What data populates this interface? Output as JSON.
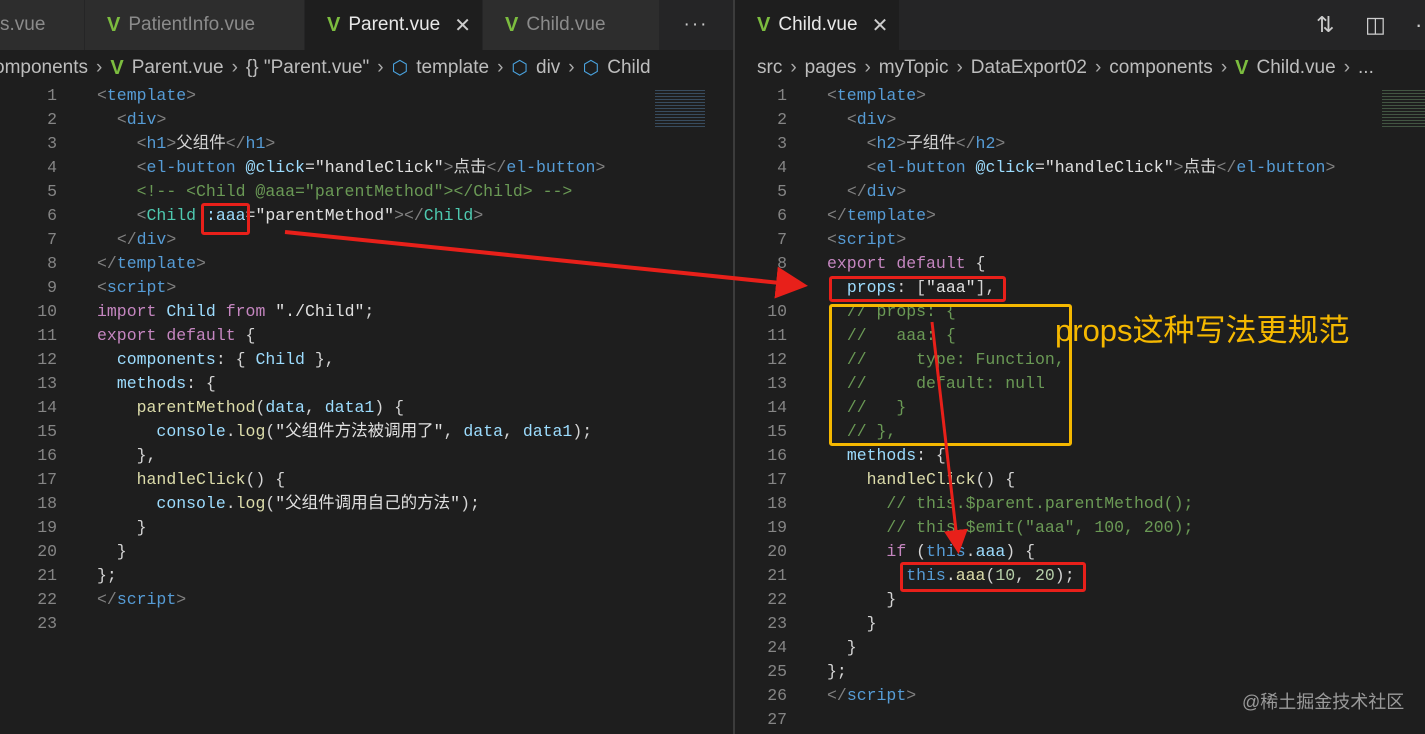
{
  "left": {
    "tabs": [
      {
        "label": "s.vue",
        "active": false
      },
      {
        "label": "PatientInfo.vue",
        "active": false
      },
      {
        "label": "Parent.vue",
        "active": true
      },
      {
        "label": "Child.vue",
        "active": false
      }
    ],
    "more": "···",
    "crumbs": [
      "omponents",
      "Parent.vue",
      "{} \"Parent.vue\"",
      "template",
      "div",
      "Child"
    ],
    "lines": [
      [
        [
          "p",
          "<"
        ],
        [
          "t",
          "template"
        ],
        [
          "p",
          ">"
        ]
      ],
      [
        [
          "x",
          "  "
        ],
        [
          "p",
          "<"
        ],
        [
          "t",
          "div"
        ],
        [
          "p",
          ">"
        ]
      ],
      [
        [
          "x",
          "    "
        ],
        [
          "p",
          "<"
        ],
        [
          "t",
          "h1"
        ],
        [
          "p",
          ">"
        ],
        [
          "x",
          "父组件"
        ],
        [
          "p",
          "</"
        ],
        [
          "t",
          "h1"
        ],
        [
          "p",
          ">"
        ]
      ],
      [
        [
          "x",
          "    "
        ],
        [
          "p",
          "<"
        ],
        [
          "t",
          "el-button"
        ],
        [
          "x",
          " "
        ],
        [
          "a",
          "@click"
        ],
        [
          "x",
          "="
        ],
        [
          "s",
          "\"handleClick\""
        ],
        [
          "p",
          ">"
        ],
        [
          "x",
          "点击"
        ],
        [
          "p",
          "</"
        ],
        [
          "t",
          "el-button"
        ],
        [
          "p",
          ">"
        ]
      ],
      [
        [
          "x",
          "    "
        ],
        [
          "m",
          "<!-- <Child @aaa=\"parentMethod\"></Child> -->"
        ]
      ],
      [
        [
          "x",
          "    "
        ],
        [
          "p",
          "<"
        ],
        [
          "c",
          "Child"
        ],
        [
          "x",
          " "
        ],
        [
          "a",
          ":aaa"
        ],
        [
          "x",
          "="
        ],
        [
          "s",
          "\"parentMethod\""
        ],
        [
          "p",
          "></"
        ],
        [
          "c",
          "Child"
        ],
        [
          "p",
          ">"
        ]
      ],
      [
        [
          "x",
          "  "
        ],
        [
          "p",
          "</"
        ],
        [
          "t",
          "div"
        ],
        [
          "p",
          ">"
        ]
      ],
      [
        [
          "p",
          "</"
        ],
        [
          "t",
          "template"
        ],
        [
          "p",
          ">"
        ]
      ],
      [
        [
          "p",
          "<"
        ],
        [
          "t",
          "script"
        ],
        [
          "p",
          ">"
        ]
      ],
      [
        [
          "k",
          "import"
        ],
        [
          "x",
          " "
        ],
        [
          "v",
          "Child"
        ],
        [
          "x",
          " "
        ],
        [
          "k",
          "from"
        ],
        [
          "x",
          " "
        ],
        [
          "s",
          "\"./Child\""
        ],
        [
          "x",
          ";"
        ]
      ],
      [
        [
          "k",
          "export"
        ],
        [
          "x",
          " "
        ],
        [
          "k",
          "default"
        ],
        [
          "x",
          " {"
        ]
      ],
      [
        [
          "x",
          "  "
        ],
        [
          "v",
          "components"
        ],
        [
          "x",
          ": { "
        ],
        [
          "v",
          "Child"
        ],
        [
          "x",
          " },"
        ]
      ],
      [
        [
          "x",
          "  "
        ],
        [
          "v",
          "methods"
        ],
        [
          "x",
          ": {"
        ]
      ],
      [
        [
          "x",
          "    "
        ],
        [
          "f",
          "parentMethod"
        ],
        [
          "x",
          "("
        ],
        [
          "v",
          "data"
        ],
        [
          "x",
          ", "
        ],
        [
          "v",
          "data1"
        ],
        [
          "x",
          ") {"
        ]
      ],
      [
        [
          "x",
          "      "
        ],
        [
          "v",
          "console"
        ],
        [
          "x",
          "."
        ],
        [
          "f",
          "log"
        ],
        [
          "x",
          "("
        ],
        [
          "s",
          "\"父组件方法被调用了\""
        ],
        [
          "x",
          ", "
        ],
        [
          "v",
          "data"
        ],
        [
          "x",
          ", "
        ],
        [
          "v",
          "data1"
        ],
        [
          "x",
          ");"
        ]
      ],
      [
        [
          "x",
          "    },"
        ]
      ],
      [
        [
          "x",
          "    "
        ],
        [
          "f",
          "handleClick"
        ],
        [
          "x",
          "() {"
        ]
      ],
      [
        [
          "x",
          "      "
        ],
        [
          "v",
          "console"
        ],
        [
          "x",
          "."
        ],
        [
          "f",
          "log"
        ],
        [
          "x",
          "("
        ],
        [
          "s",
          "\"父组件调用自己的方法\""
        ],
        [
          "x",
          ");"
        ]
      ],
      [
        [
          "x",
          "    }"
        ]
      ],
      [
        [
          "x",
          "  }"
        ]
      ],
      [
        [
          "x",
          "};"
        ]
      ],
      [
        [
          "p",
          "</"
        ],
        [
          "t",
          "script"
        ],
        [
          "p",
          ">"
        ]
      ],
      []
    ]
  },
  "right": {
    "tabs": [
      {
        "label": "Child.vue",
        "active": true
      }
    ],
    "crumbs": [
      "src",
      "pages",
      "myTopic",
      "DataExport02",
      "components",
      "Child.vue",
      "..."
    ],
    "icons": [
      "compare-changes-icon",
      "split-editor-icon",
      "more-actions-icon"
    ],
    "lines": [
      [
        [
          "p",
          "<"
        ],
        [
          "t",
          "template"
        ],
        [
          "p",
          ">"
        ]
      ],
      [
        [
          "x",
          "  "
        ],
        [
          "p",
          "<"
        ],
        [
          "t",
          "div"
        ],
        [
          "p",
          ">"
        ]
      ],
      [
        [
          "x",
          "    "
        ],
        [
          "p",
          "<"
        ],
        [
          "t",
          "h2"
        ],
        [
          "p",
          ">"
        ],
        [
          "x",
          "子组件"
        ],
        [
          "p",
          "</"
        ],
        [
          "t",
          "h2"
        ],
        [
          "p",
          ">"
        ]
      ],
      [
        [
          "x",
          "    "
        ],
        [
          "p",
          "<"
        ],
        [
          "t",
          "el-button"
        ],
        [
          "x",
          " "
        ],
        [
          "a",
          "@click"
        ],
        [
          "x",
          "="
        ],
        [
          "s",
          "\"handleClick\""
        ],
        [
          "p",
          ">"
        ],
        [
          "x",
          "点击"
        ],
        [
          "p",
          "</"
        ],
        [
          "t",
          "el-button"
        ],
        [
          "p",
          ">"
        ]
      ],
      [
        [
          "x",
          "  "
        ],
        [
          "p",
          "</"
        ],
        [
          "t",
          "div"
        ],
        [
          "p",
          ">"
        ]
      ],
      [
        [
          "p",
          "</"
        ],
        [
          "t",
          "template"
        ],
        [
          "p",
          ">"
        ]
      ],
      [
        [
          "p",
          "<"
        ],
        [
          "t",
          "script"
        ],
        [
          "p",
          ">"
        ]
      ],
      [
        [
          "k",
          "export"
        ],
        [
          "x",
          " "
        ],
        [
          "k",
          "default"
        ],
        [
          "x",
          " {"
        ]
      ],
      [
        [
          "x",
          "  "
        ],
        [
          "v",
          "props"
        ],
        [
          "x",
          ": ["
        ],
        [
          "s",
          "\"aaa\""
        ],
        [
          "x",
          "],"
        ]
      ],
      [
        [
          "x",
          "  "
        ],
        [
          "m",
          "// props: {"
        ]
      ],
      [
        [
          "x",
          "  "
        ],
        [
          "m",
          "//   aaa: {"
        ]
      ],
      [
        [
          "x",
          "  "
        ],
        [
          "m",
          "//     type: Function,"
        ]
      ],
      [
        [
          "x",
          "  "
        ],
        [
          "m",
          "//     default: null"
        ]
      ],
      [
        [
          "x",
          "  "
        ],
        [
          "m",
          "//   }"
        ]
      ],
      [
        [
          "x",
          "  "
        ],
        [
          "m",
          "// },"
        ]
      ],
      [
        [
          "x",
          "  "
        ],
        [
          "v",
          "methods"
        ],
        [
          "x",
          ": {"
        ]
      ],
      [
        [
          "x",
          "    "
        ],
        [
          "f",
          "handleClick"
        ],
        [
          "x",
          "() {"
        ]
      ],
      [
        [
          "x",
          "      "
        ],
        [
          "m",
          "// this.$parent.parentMethod();"
        ]
      ],
      [
        [
          "x",
          "      "
        ],
        [
          "m",
          "// this.$emit(\"aaa\", 100, 200);"
        ]
      ],
      [
        [
          "x",
          "      "
        ],
        [
          "k",
          "if"
        ],
        [
          "x",
          " ("
        ],
        [
          "th",
          "this"
        ],
        [
          "x",
          "."
        ],
        [
          "v",
          "aaa"
        ],
        [
          "x",
          ") {"
        ]
      ],
      [
        [
          "x",
          "        "
        ],
        [
          "th",
          "this"
        ],
        [
          "x",
          "."
        ],
        [
          "f",
          "aaa"
        ],
        [
          "x",
          "("
        ],
        [
          "n",
          "10"
        ],
        [
          "x",
          ", "
        ],
        [
          "n",
          "20"
        ],
        [
          "x",
          ");"
        ]
      ],
      [
        [
          "x",
          "      }"
        ]
      ],
      [
        [
          "x",
          "    }"
        ]
      ],
      [
        [
          "x",
          "  }"
        ]
      ],
      [
        [
          "x",
          "};"
        ]
      ],
      [
        [
          "p",
          "</"
        ],
        [
          "t",
          "script"
        ],
        [
          "p",
          ">"
        ]
      ],
      []
    ]
  },
  "annotation": "props这种写法更规范",
  "watermark": "@稀土掘金技术社区",
  "colors": {
    "annotation_box": "#f5b800",
    "highlight_box": "#e8201a",
    "arrow": "#e8201a",
    "vue_icon": "#7cbd3f"
  }
}
